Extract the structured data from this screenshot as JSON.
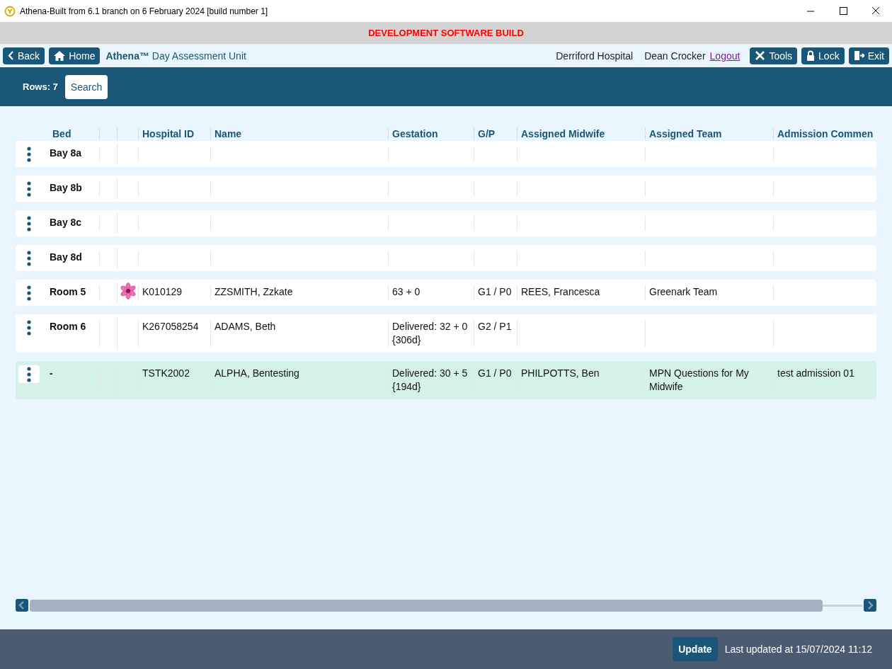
{
  "window": {
    "title": "Athena-Built from 6.1 branch on 6 February 2024 [build number 1]"
  },
  "banner": "DEVELOPMENT SOFTWARE BUILD",
  "nav": {
    "back": "Back",
    "home": "Home",
    "app_title": "**Athena™** Day Assessment Unit",
    "hospital": "Derriford Hospital",
    "user": "Dean Crocker",
    "logout": "Logout",
    "tools": "Tools",
    "lock": "Lock",
    "exit": "Exit"
  },
  "toolbar": {
    "rows": "Rows: 7",
    "search": "Search"
  },
  "table": {
    "columns": [
      "Bed",
      "",
      "",
      "Hospital ID",
      "Name",
      "Gestation",
      "G/P",
      "Assigned Midwife",
      "Assigned Team",
      "Admission Commen"
    ],
    "rows": [
      {
        "bed": "Bay 8a",
        "flagged": false,
        "hospital_id": "",
        "name": "",
        "gestation": "",
        "gp": "",
        "midwife": "",
        "team": "",
        "comment": "",
        "selected": false
      },
      {
        "bed": "Bay 8b",
        "flagged": false,
        "hospital_id": "",
        "name": "",
        "gestation": "",
        "gp": "",
        "midwife": "",
        "team": "",
        "comment": "",
        "selected": false
      },
      {
        "bed": "Bay 8c",
        "flagged": false,
        "hospital_id": "",
        "name": "",
        "gestation": "",
        "gp": "",
        "midwife": "",
        "team": "",
        "comment": "",
        "selected": false
      },
      {
        "bed": "Bay 8d",
        "flagged": false,
        "hospital_id": "",
        "name": "",
        "gestation": "",
        "gp": "",
        "midwife": "",
        "team": "",
        "comment": "",
        "selected": false
      },
      {
        "bed": "Room 5",
        "flagged": true,
        "hospital_id": "K010129",
        "name": "ZZSMITH, Zzkate",
        "gestation": "63 + 0",
        "gp": "G1 / P0",
        "midwife": "REES, Francesca",
        "team": "Greenark Team",
        "comment": "",
        "selected": false
      },
      {
        "bed": "Room 6",
        "flagged": false,
        "hospital_id": "K267058254",
        "name": "ADAMS, Beth",
        "gestation": "Delivered: 32 + 0 {306d}",
        "gp": "G2 / P1",
        "midwife": "",
        "team": "",
        "comment": "",
        "selected": false
      },
      {
        "bed": "-",
        "flagged": false,
        "hospital_id": "TSTK2002",
        "name": "ALPHA, Bentesting",
        "gestation": "Delivered: 30 + 5 {194d}",
        "gp": "G1 / P0",
        "midwife": "PHILPOTTS, Ben",
        "team": "MPN Questions for My Midwife",
        "comment": "test admission 01",
        "selected": true
      }
    ]
  },
  "footer": {
    "update": "Update",
    "last_updated": "Last updated at 15/07/2024 11:12"
  }
}
